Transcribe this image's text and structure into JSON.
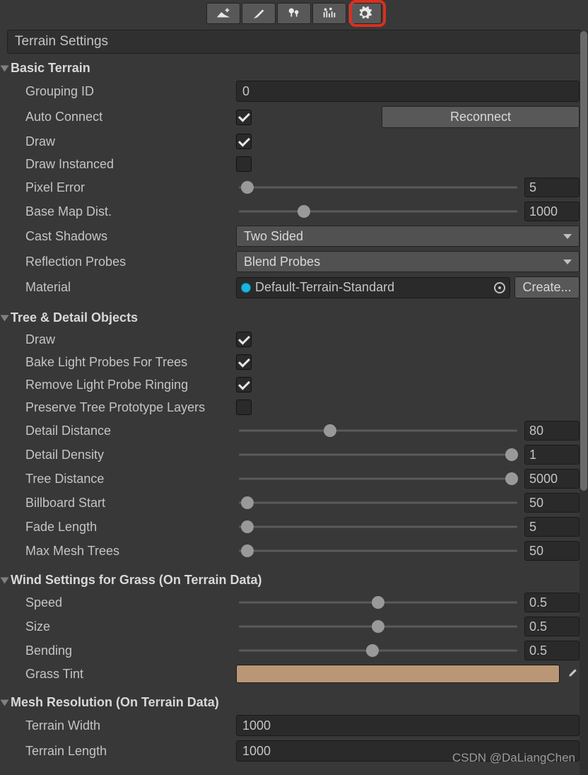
{
  "title": "Terrain Settings",
  "toolbar": {
    "items": [
      "terrain-raise-icon",
      "paint-brush-icon",
      "trees-icon",
      "details-icon",
      "settings-gear-icon"
    ]
  },
  "sections": {
    "basic": {
      "title": "Basic Terrain",
      "groupingId": {
        "label": "Grouping ID",
        "value": "0"
      },
      "autoConnect": {
        "label": "Auto Connect",
        "checked": true,
        "button": "Reconnect"
      },
      "draw": {
        "label": "Draw",
        "checked": true
      },
      "drawInstanced": {
        "label": "Draw Instanced",
        "checked": false
      },
      "pixelError": {
        "label": "Pixel Error",
        "value": "5",
        "pct": 4
      },
      "baseMapDist": {
        "label": "Base Map Dist.",
        "value": "1000",
        "pct": 24
      },
      "castShadows": {
        "label": "Cast Shadows",
        "value": "Two Sided"
      },
      "reflectionProbes": {
        "label": "Reflection Probes",
        "value": "Blend Probes"
      },
      "material": {
        "label": "Material",
        "value": "Default-Terrain-Standard",
        "button": "Create..."
      }
    },
    "tree": {
      "title": "Tree & Detail Objects",
      "draw": {
        "label": "Draw",
        "checked": true
      },
      "bakeLightProbes": {
        "label": "Bake Light Probes For Trees",
        "checked": true
      },
      "removeRinging": {
        "label": "Remove Light Probe Ringing",
        "checked": true
      },
      "preserveLayers": {
        "label": "Preserve Tree Prototype Layers",
        "checked": false
      },
      "detailDistance": {
        "label": "Detail Distance",
        "value": "80",
        "pct": 33
      },
      "detailDensity": {
        "label": "Detail Density",
        "value": "1",
        "pct": 97
      },
      "treeDistance": {
        "label": "Tree Distance",
        "value": "5000",
        "pct": 97
      },
      "billboardStart": {
        "label": "Billboard Start",
        "value": "50",
        "pct": 4
      },
      "fadeLength": {
        "label": "Fade Length",
        "value": "5",
        "pct": 4
      },
      "maxMeshTrees": {
        "label": "Max Mesh Trees",
        "value": "50",
        "pct": 4
      }
    },
    "wind": {
      "title": "Wind Settings for Grass (On Terrain Data)",
      "speed": {
        "label": "Speed",
        "value": "0.5",
        "pct": 50
      },
      "size": {
        "label": "Size",
        "value": "0.5",
        "pct": 50
      },
      "bending": {
        "label": "Bending",
        "value": "0.5",
        "pct": 48
      },
      "grassTint": {
        "label": "Grass Tint",
        "color": "#b99776"
      }
    },
    "mesh": {
      "title": "Mesh Resolution (On Terrain Data)",
      "terrainWidth": {
        "label": "Terrain Width",
        "value": "1000"
      },
      "terrainLength": {
        "label": "Terrain Length",
        "value": "1000"
      }
    }
  },
  "watermark": "CSDN @DaLiangChen"
}
